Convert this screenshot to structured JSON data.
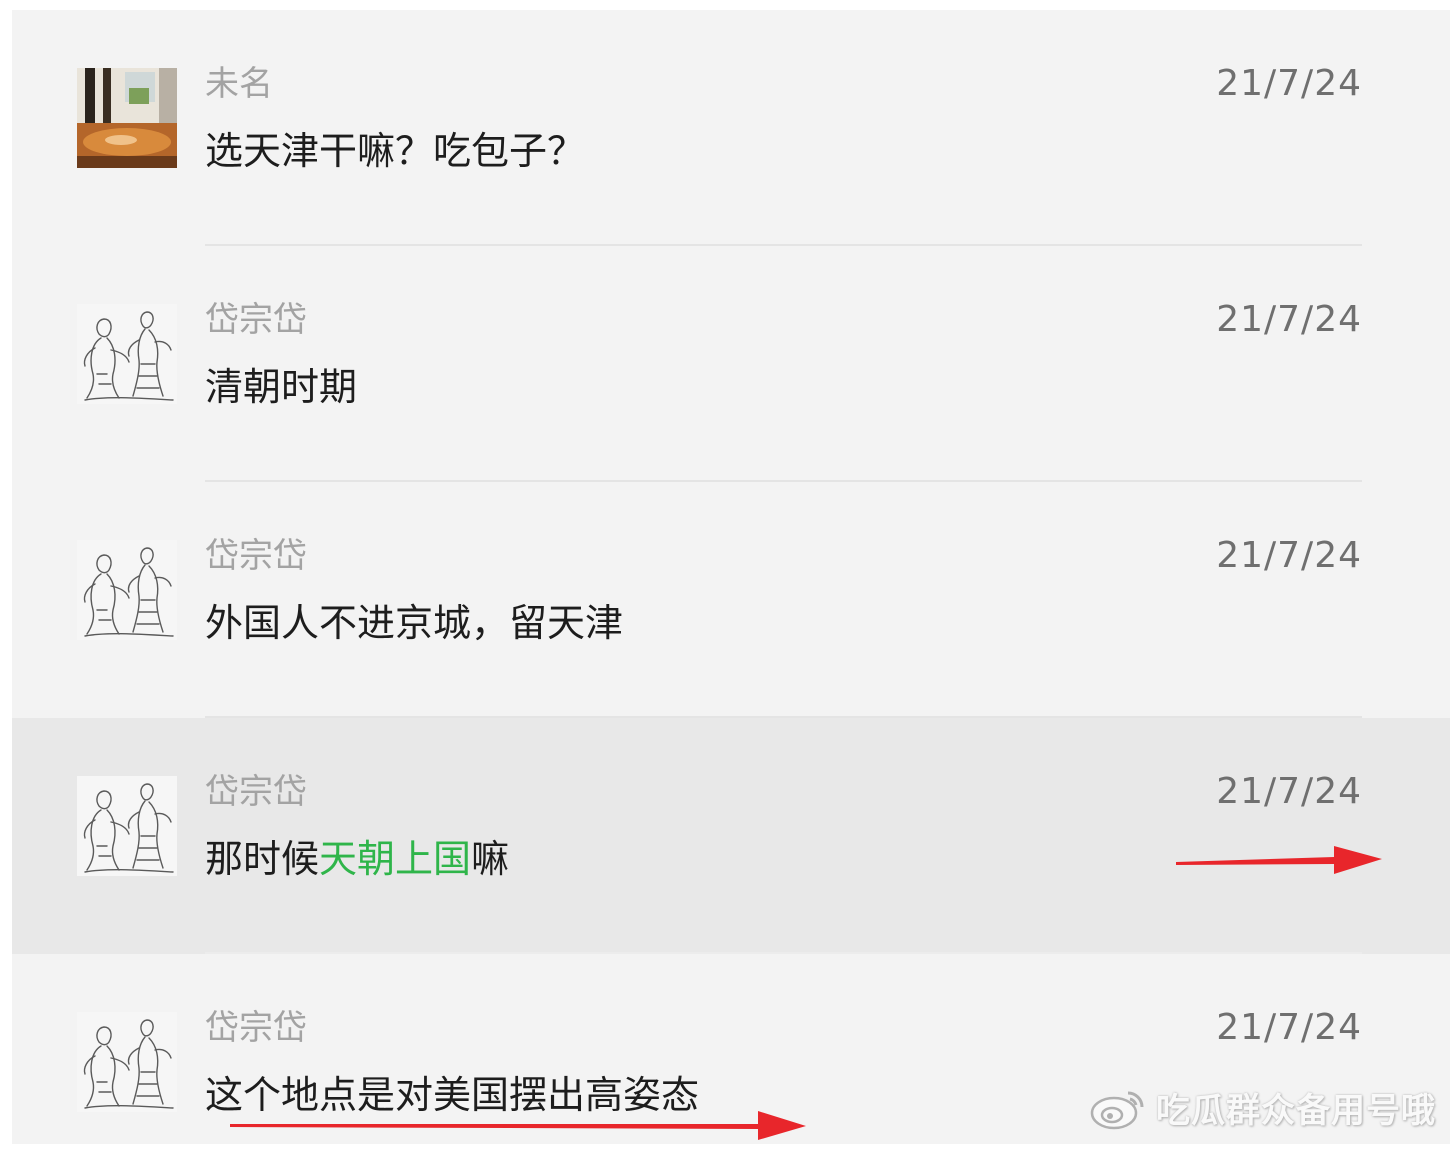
{
  "comments": [
    {
      "sender": "未名",
      "date": "21/7/24",
      "message": "选天津干嘛？吃包子？",
      "avatar": "photo-avatar-icon"
    },
    {
      "sender": "岱宗岱",
      "date": "21/7/24",
      "message": "清朝时期",
      "avatar": "sketch-figures-avatar-icon"
    },
    {
      "sender": "岱宗岱",
      "date": "21/7/24",
      "message": "外国人不进京城，留天津",
      "avatar": "sketch-figures-avatar-icon"
    },
    {
      "sender": "岱宗岱",
      "date": "21/7/24",
      "message_before": "那时候",
      "message_highlight": "天朝上国",
      "message_after": "嘛",
      "avatar": "sketch-figures-avatar-icon",
      "highlighted": true
    },
    {
      "sender": "岱宗岱",
      "date": "21/7/24",
      "message": "这个地点是对美国摆出高姿态",
      "avatar": "sketch-figures-avatar-icon"
    }
  ],
  "watermark": {
    "text": "吃瓜群众备用号哦",
    "icon": "weibo-logo-icon"
  },
  "annotations": {
    "arrow_icon": "red-arrow-icon",
    "arrow_color": "#e8262b"
  },
  "colors": {
    "highlight_text": "#2fb54a",
    "panel_bg": "#f3f3f3",
    "row_highlight_bg": "#e8e8e8"
  }
}
